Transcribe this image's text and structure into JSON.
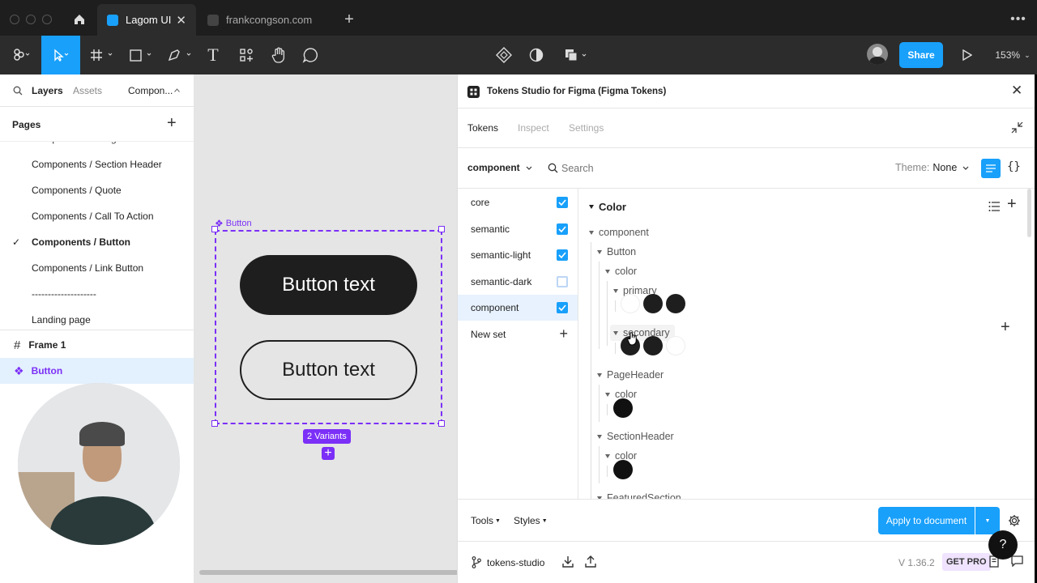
{
  "browser": {
    "tabs": [
      {
        "label": "Lagom UI"
      },
      {
        "label": "frankcongson.com"
      }
    ]
  },
  "toolbar": {
    "share_label": "Share",
    "zoom": "153%"
  },
  "left_panel": {
    "tabs": {
      "layers": "Layers",
      "assets": "Assets",
      "page_selector": "Compon..."
    },
    "pages_heading": "Pages",
    "pages": [
      "Components / Section Header",
      "Components / Quote",
      "Components / Call To Action",
      "Components / Button",
      "Components / Link Button",
      "--------------------",
      "Landing page"
    ],
    "current_page": "Components / Button",
    "layers": [
      {
        "label": "Frame 1"
      },
      {
        "label": "Button"
      }
    ]
  },
  "canvas": {
    "component_label": "Button",
    "variant_button_1": "Button text",
    "variant_button_2": "Button text",
    "variants_badge": "2 Variants"
  },
  "plugin": {
    "title": "Tokens Studio for Figma (Figma Tokens)",
    "tabs": [
      "Tokens",
      "Inspect",
      "Settings"
    ],
    "set_selector": "component",
    "search_placeholder": "Search",
    "theme_label": "Theme:",
    "theme_value": "None",
    "sets": [
      {
        "name": "core",
        "checked": true
      },
      {
        "name": "semantic",
        "checked": true
      },
      {
        "name": "semantic-light",
        "checked": true
      },
      {
        "name": "semantic-dark",
        "checked": false
      },
      {
        "name": "component",
        "checked": true
      }
    ],
    "new_set_label": "New set",
    "section_title": "Color",
    "tree": {
      "root": "component",
      "button": "Button",
      "color": "color",
      "primary": "primary",
      "secondary": "secondary",
      "pageheader": "PageHeader",
      "pageheader_color": "color",
      "sectionheader": "SectionHeader",
      "sectionheader_color": "color",
      "featured": "FeaturedSection"
    },
    "swatch_colors": {
      "primary": [
        "#ffffff",
        "#1e1e1e",
        "#1e1e1e"
      ],
      "secondary": [
        "#1e1e1e",
        "#1e1e1e",
        "#ffffff"
      ],
      "pageheader": [
        "#111111"
      ],
      "sectionheader": [
        "#111111"
      ]
    },
    "footer": {
      "tools": "Tools",
      "styles": "Styles",
      "apply": "Apply to document",
      "storage": "tokens-studio",
      "version": "V 1.36.2",
      "getpro": "GET PRO",
      "help": "?"
    }
  },
  "colors": {
    "figma_blue": "#18a0fb",
    "component_purple": "#7b2ff7",
    "dark": "#2c2c2c"
  }
}
